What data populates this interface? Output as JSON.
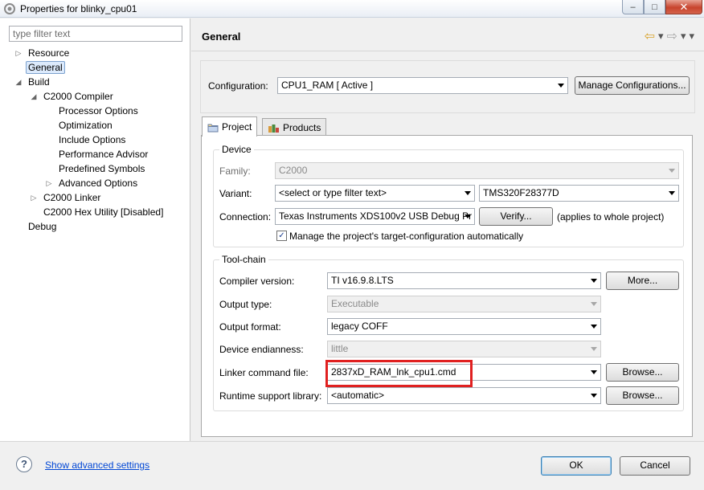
{
  "window": {
    "title": "Properties for blinky_cpu01",
    "minimize_label": "–",
    "maximize_label": "□",
    "close_label": "✕"
  },
  "sidebar": {
    "filter_placeholder": "type filter text",
    "items": [
      {
        "label": "Resource",
        "toggle": "▷"
      },
      {
        "label": "General",
        "toggle": ""
      },
      {
        "label": "Build",
        "toggle": "◢"
      },
      {
        "label": "C2000 Compiler",
        "toggle": "◢"
      },
      {
        "label": "Processor Options",
        "toggle": ""
      },
      {
        "label": "Optimization",
        "toggle": ""
      },
      {
        "label": "Include Options",
        "toggle": ""
      },
      {
        "label": "Performance Advisor",
        "toggle": ""
      },
      {
        "label": "Predefined Symbols",
        "toggle": ""
      },
      {
        "label": "Advanced Options",
        "toggle": "▷"
      },
      {
        "label": "C2000 Linker",
        "toggle": "▷"
      },
      {
        "label": "C2000 Hex Utility  [Disabled]",
        "toggle": ""
      },
      {
        "label": "Debug",
        "toggle": ""
      }
    ],
    "selected": "General"
  },
  "header": {
    "title": "General",
    "back_icon": "back-arrow-icon",
    "forward_icon": "forward-arrow-icon"
  },
  "configuration": {
    "label": "Configuration:",
    "value": "CPU1_RAM  [ Active ]",
    "manage_button": "Manage Configurations..."
  },
  "tabs": [
    {
      "label": "Project",
      "icon": "folder-icon",
      "active": true
    },
    {
      "label": "Products",
      "icon": "products-icon",
      "active": false
    }
  ],
  "device": {
    "group_title": "Device",
    "family_label": "Family:",
    "family_value": "C2000",
    "variant_label": "Variant:",
    "variant_filter": "<select or type filter text>",
    "variant_value": "TMS320F28377D",
    "connection_label": "Connection:",
    "connection_value": "Texas Instruments XDS100v2 USB Debug Pr",
    "verify_button": "Verify...",
    "verify_note": "(applies to whole project)",
    "manage_target_label": "Manage the project's target-configuration automatically",
    "manage_target_checked": "✓"
  },
  "toolchain": {
    "group_title": "Tool-chain",
    "compiler_label": "Compiler version:",
    "compiler_value": "TI v16.9.8.LTS",
    "more_button": "More...",
    "output_type_label": "Output type:",
    "output_type_value": "Executable",
    "output_format_label": "Output format:",
    "output_format_value": "legacy COFF",
    "endianness_label": "Device endianness:",
    "endianness_value": "little",
    "linker_cmd_label": "Linker command file:",
    "linker_cmd_value": "2837xD_RAM_lnk_cpu1.cmd",
    "browse_button": "Browse...",
    "runtime_label": "Runtime support library:",
    "runtime_value": "<automatic>"
  },
  "footer": {
    "help_icon": "?",
    "advanced_link": "Show advanced settings",
    "ok_button": "OK",
    "cancel_button": "Cancel"
  },
  "colors": {
    "highlight_border": "#e02020",
    "link": "#0046d5",
    "selection": "#dceafc"
  }
}
